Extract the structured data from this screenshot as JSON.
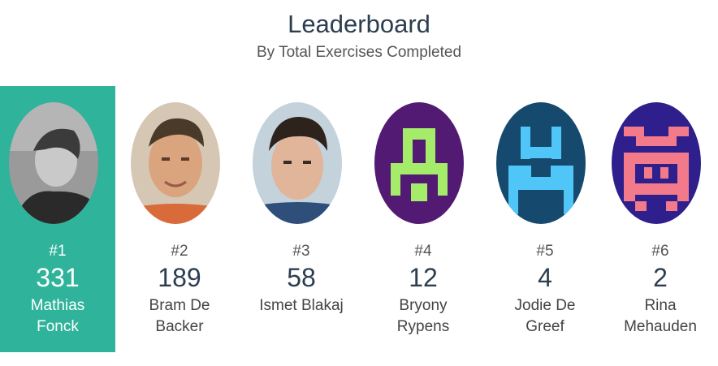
{
  "header": {
    "title": "Leaderboard",
    "subtitle": "By Total Exercises Completed"
  },
  "colors": {
    "highlight": "#2fb39b",
    "text": "#2c3e50"
  },
  "leaders": [
    {
      "rank": "#1",
      "count": "331",
      "name_line1": "Mathias",
      "name_line2": "Fonck",
      "avatar": "photo-grayscale"
    },
    {
      "rank": "#2",
      "count": "189",
      "name_line1": "Bram De",
      "name_line2": "Backer",
      "avatar": "photo"
    },
    {
      "rank": "#3",
      "count": "58",
      "name_line1": "Ismet Blakaj",
      "name_line2": "",
      "avatar": "photo"
    },
    {
      "rank": "#4",
      "count": "12",
      "name_line1": "Bryony",
      "name_line2": "Rypens",
      "avatar": "identicon-green-on-purple"
    },
    {
      "rank": "#5",
      "count": "4",
      "name_line1": "Jodie De",
      "name_line2": "Greef",
      "avatar": "identicon-blue-on-navy"
    },
    {
      "rank": "#6",
      "count": "2",
      "name_line1": "Rina",
      "name_line2": "Mehauden",
      "avatar": "identicon-pink-on-indigo"
    }
  ]
}
